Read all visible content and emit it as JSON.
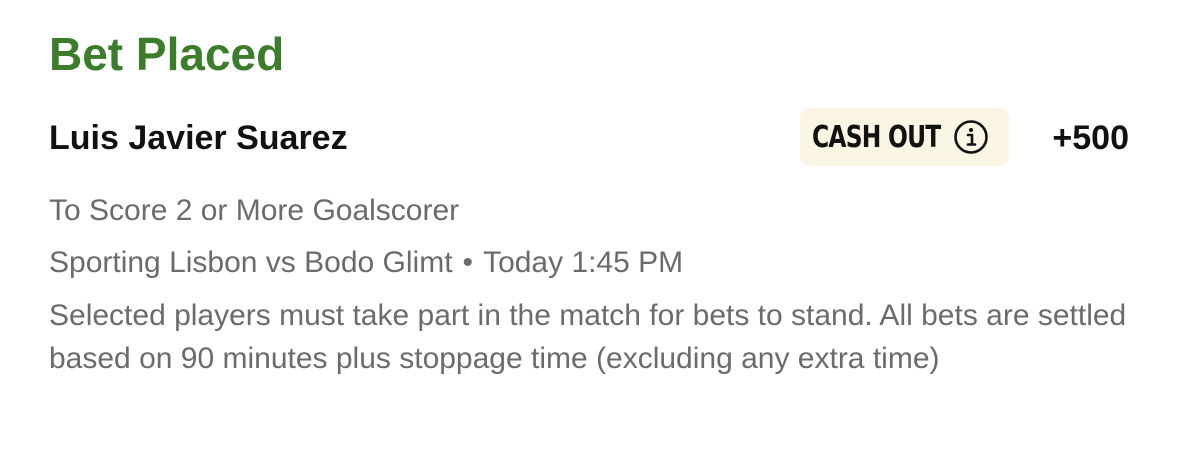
{
  "status": {
    "title": "Bet Placed",
    "color": "#3b7d2a"
  },
  "selection": {
    "player": "Luis Javier Suarez",
    "odds": "+500",
    "market": "To Score 2 or More Goalscorer"
  },
  "cash_out": {
    "label": "CASH OUT",
    "icon": "info-icon",
    "background": "#fbf5e3"
  },
  "event": {
    "match": "Sporting Lisbon vs Bodo Glimt",
    "separator": "•",
    "time": "Today 1:45 PM"
  },
  "disclaimer": "Selected players must take part in the match for bets to stand. All bets are settled based on 90 minutes plus stoppage time (excluding any extra time)"
}
